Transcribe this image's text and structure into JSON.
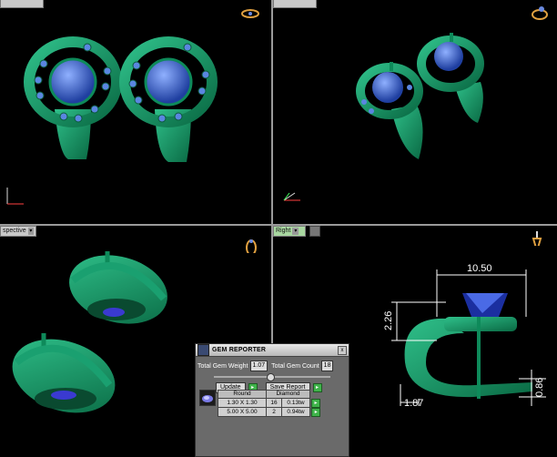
{
  "viewports": {
    "top_left": {
      "label": ""
    },
    "top_right": {
      "label": ""
    },
    "bottom_left": {
      "label": "spective"
    },
    "bottom_right": {
      "label": "Right"
    }
  },
  "dimensions": {
    "width": "10.50",
    "height": "2.26",
    "bottom": "1.87",
    "thickness": "0.86"
  },
  "gem_reporter": {
    "title": "GEM REPORTER",
    "close": "x",
    "total_gem_weight_label": "Total Gem Weight",
    "total_gem_weight": "1.07",
    "total_gem_count_label": "Total Gem Count",
    "total_gem_count": "18",
    "update_label": "Update",
    "save_report_label": "Save Report",
    "columns": [
      "Round",
      "Diamond"
    ],
    "rows": [
      {
        "size": "1.30 X 1.30",
        "count": "16",
        "weight": "0.13tw"
      },
      {
        "size": "5.00 X 5.00",
        "count": "2",
        "weight": "0.94tw"
      }
    ]
  },
  "colors": {
    "metal": "#0e8a5a",
    "metal_highlight": "#2fc08a",
    "gem": "#2f5fd0",
    "accent_button": "#3fb34a",
    "viewport_border": "#9a9a9a"
  }
}
